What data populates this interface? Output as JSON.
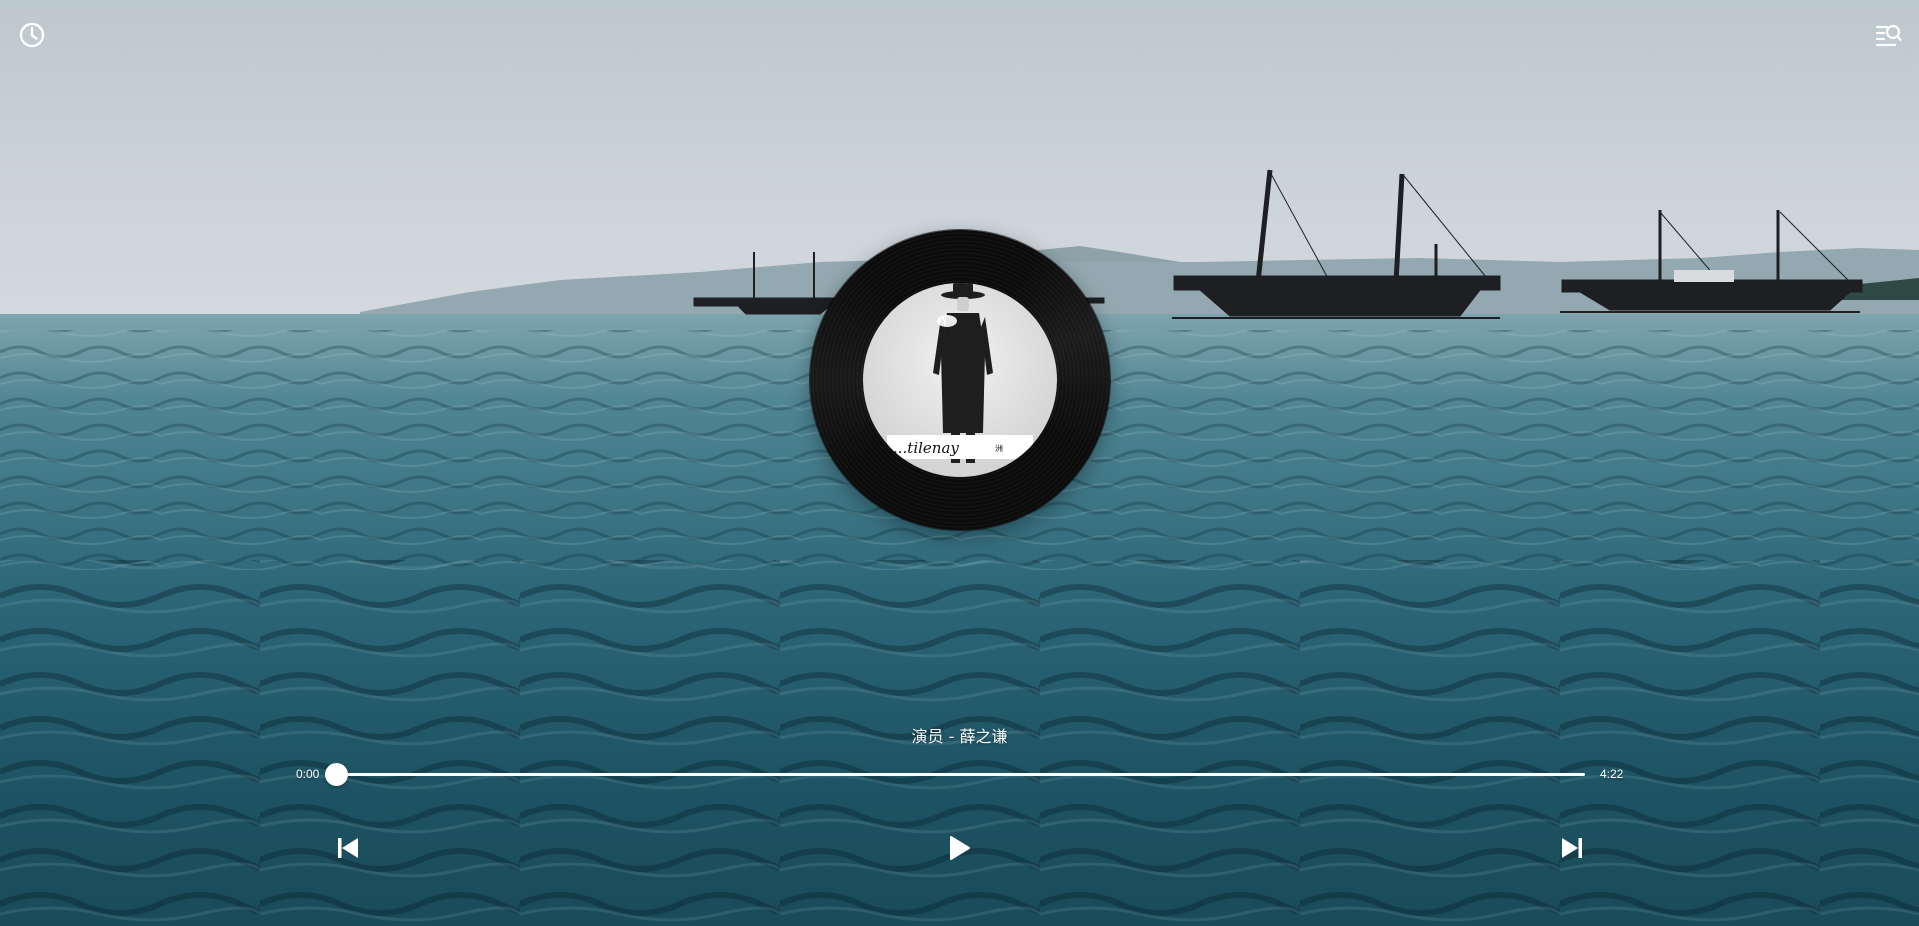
{
  "player": {
    "song_title": "演员 - 薛之谦",
    "time_current": "0:00",
    "time_total": "4:22",
    "progress": 0.0
  },
  "album": {
    "cover_text": "...tilenay",
    "cover_tag": "洲"
  },
  "icons": {
    "history": "clock-icon",
    "playlist": "playlist-search-icon",
    "previous": "skip-previous-icon",
    "play": "play-icon",
    "next": "skip-next-icon"
  },
  "colors": {
    "sky": "#c9d1d8",
    "sea": "#2e6f80",
    "record": "#0b0b0b",
    "foreground": "#ffffff"
  }
}
